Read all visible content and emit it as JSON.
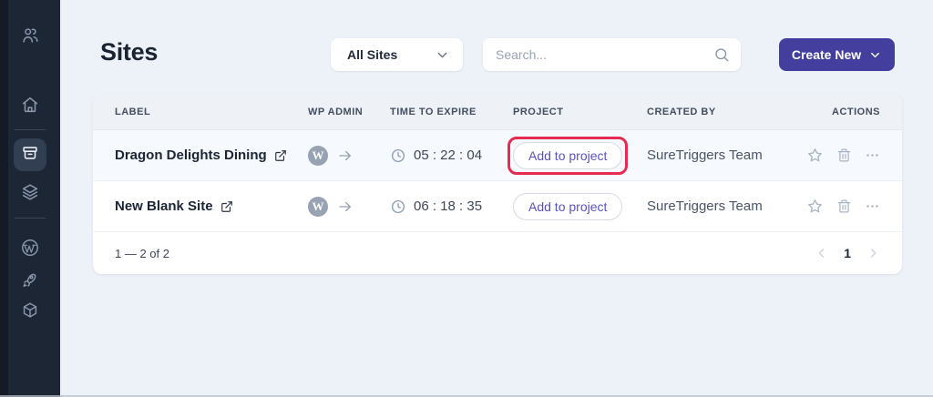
{
  "sidebar": {
    "items": [
      {
        "id": "team",
        "icon": "users-icon",
        "active": false
      },
      {
        "id": "home",
        "icon": "home-icon",
        "active": false
      },
      {
        "id": "sites",
        "icon": "archive-icon",
        "active": true
      },
      {
        "id": "layers",
        "icon": "layers-icon",
        "active": false
      },
      {
        "id": "wordpress",
        "icon": "wordpress-icon",
        "active": false
      },
      {
        "id": "launch",
        "icon": "rocket-icon",
        "active": false
      },
      {
        "id": "package",
        "icon": "cube-icon",
        "active": false
      }
    ]
  },
  "header": {
    "title": "Sites",
    "filter": {
      "value": "All Sites"
    },
    "search": {
      "placeholder": "Search..."
    },
    "create": {
      "label": "Create New"
    }
  },
  "table": {
    "columns": {
      "label": "LABEL",
      "wp_admin": "WP ADMIN",
      "time_to_expire": "TIME TO EXPIRE",
      "project": "PROJECT",
      "created_by": "CREATED BY",
      "actions": "ACTIONS"
    },
    "rows": [
      {
        "label": "Dragon Delights Dining",
        "wp_admin_icon": "wordpress-icon",
        "time_to_expire": "05 : 22 : 04",
        "project_action": "Add to project",
        "created_by": "SureTriggers Team",
        "highlighted": true
      },
      {
        "label": "New Blank Site",
        "wp_admin_icon": "wordpress-icon",
        "time_to_expire": "06 : 18 : 35",
        "project_action": "Add to project",
        "created_by": "SureTriggers Team",
        "highlighted": false
      }
    ],
    "footer": {
      "range": "1 — 2 of 2",
      "page": "1"
    }
  },
  "colors": {
    "sidebar_bg": "#1d2634",
    "sidebar_edge": "#141b26",
    "sidebar_active_bg": "#323f52",
    "page_bg": "#edf1f8",
    "accent_indigo": "#443f9e",
    "pill_text_indigo": "#5a52c3",
    "highlight_red": "#e72a4f",
    "header_row_bg": "#eef1f6",
    "tinted_row_bg": "#f6f9fd"
  },
  "wp_letter": "W"
}
